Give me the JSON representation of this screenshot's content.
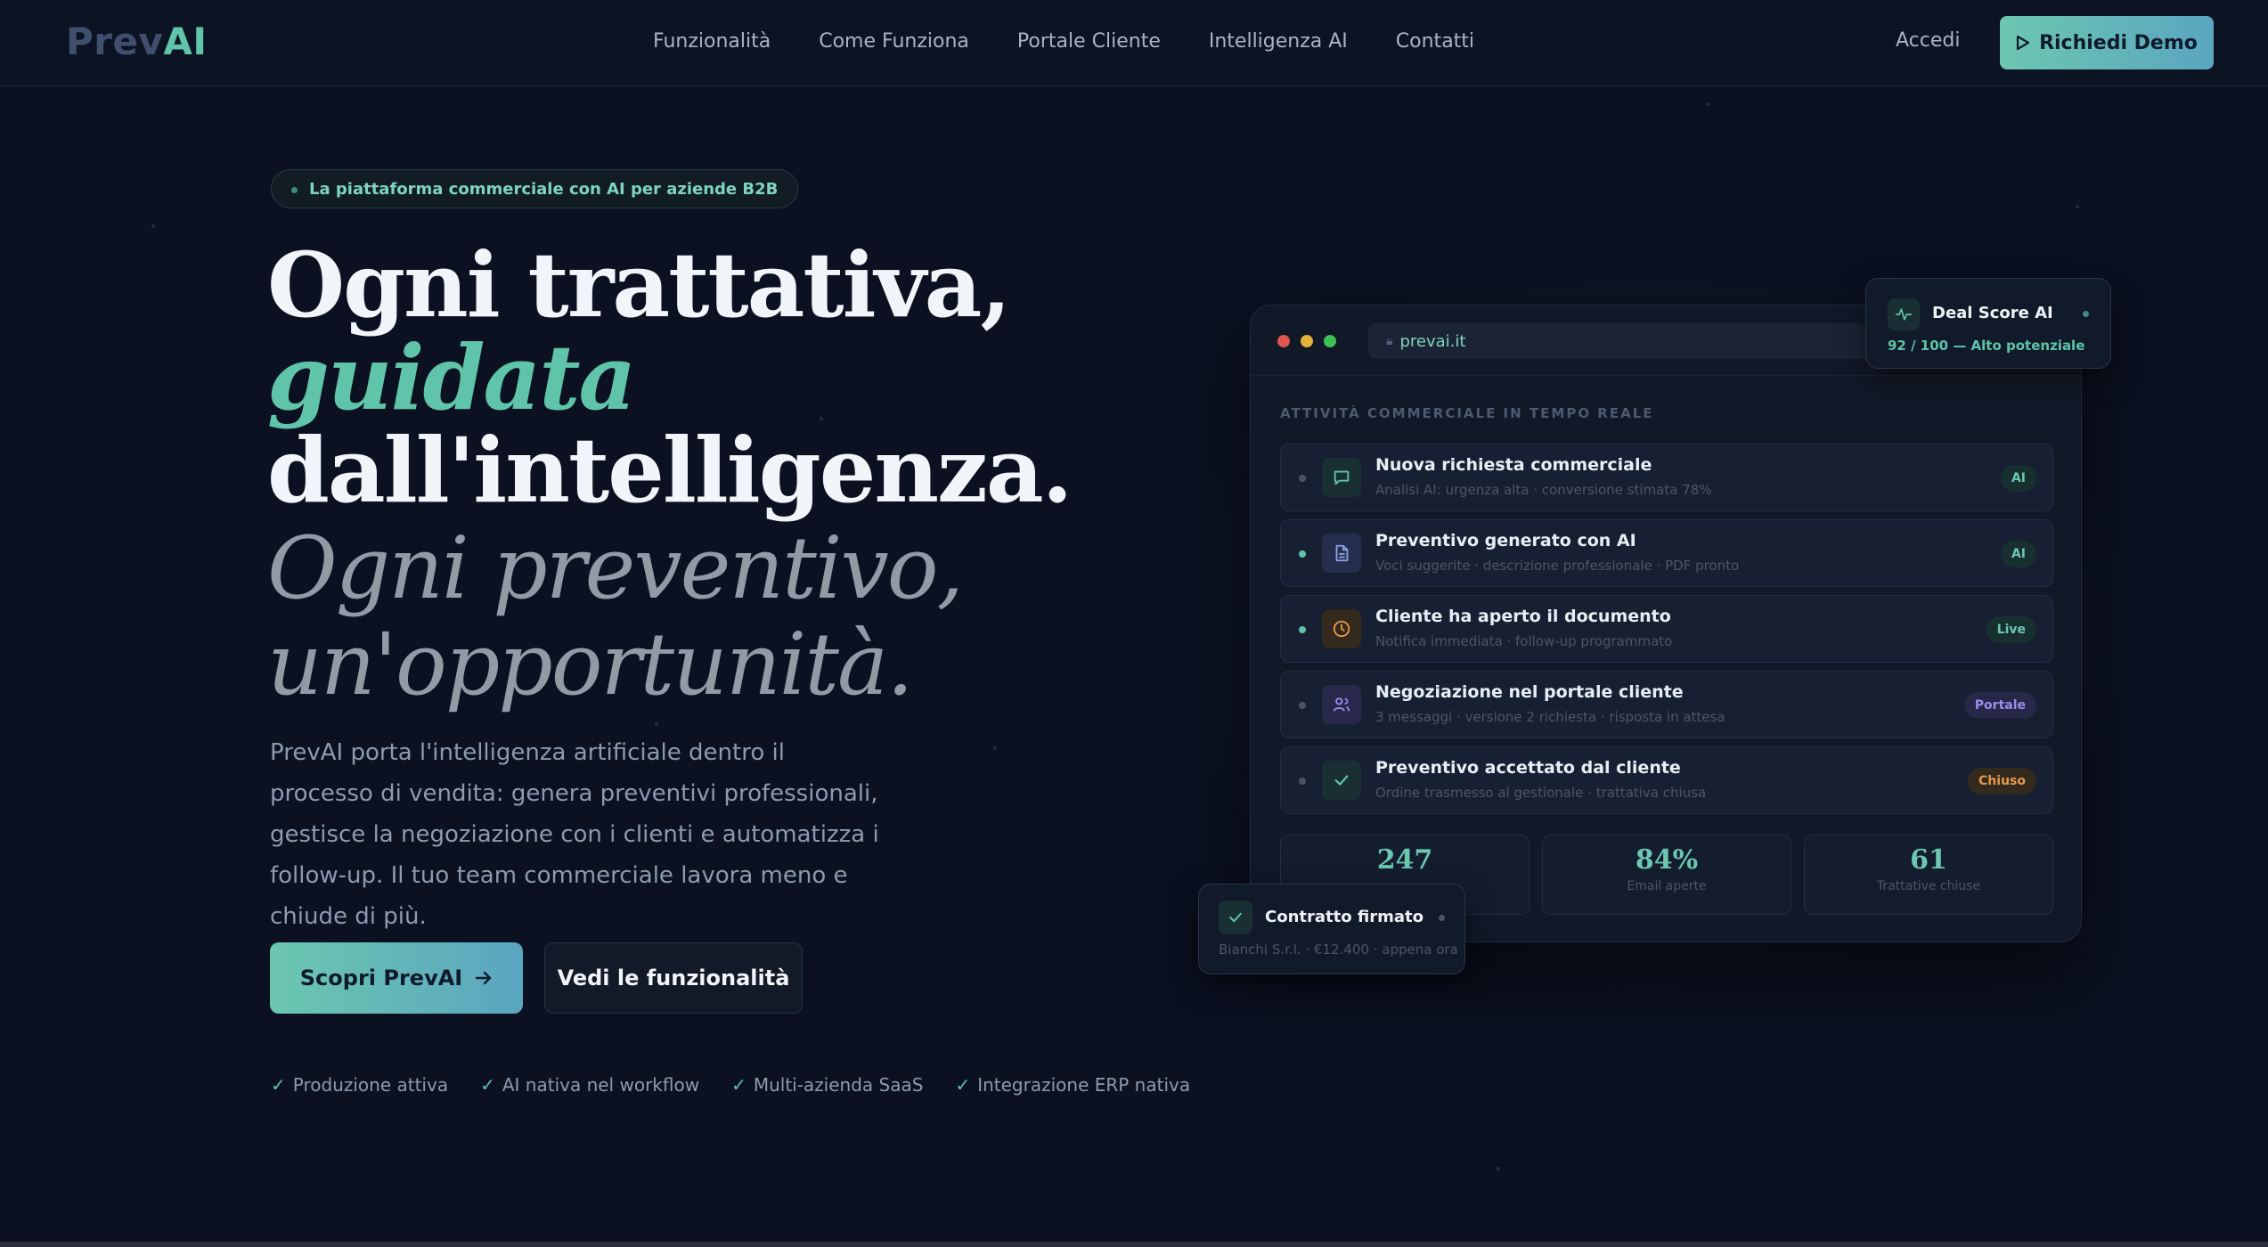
{
  "nav": {
    "logo_prev": "Prev",
    "logo_ai": "AI",
    "links": [
      "Funzionalità",
      "Come Funziona",
      "Portale Cliente",
      "Intelligenza AI",
      "Contatti"
    ],
    "login": "Accedi",
    "demo": "Richiedi Demo"
  },
  "hero": {
    "badge": "La piattaforma commerciale con AI per aziende B2B",
    "title_line1": "Ogni trattativa,",
    "title_line2": "guidata",
    "title_line3": "dall'intelligenza.",
    "subtitle_line1": "Ogni preventivo,",
    "subtitle_line2": "un'opportunità.",
    "paragraph": "PrevAI porta l'intelligenza artificiale dentro il processo di vendita: genera preventivi professionali, gestisce la negoziazione con i clienti e automatizza i follow-up. Il tuo team commerciale lavora meno e chiude di più.",
    "primary_cta": "Scopri PrevAI",
    "secondary_cta": "Vedi le funzionalità",
    "checks": [
      "Produzione attiva",
      "AI nativa nel workflow",
      "Multi-azienda SaaS",
      "Integrazione ERP nativa"
    ]
  },
  "mockup": {
    "url": "prevai.it",
    "section_title": "ATTIVITÀ COMMERCIALE IN TEMPO REALE",
    "rows": [
      {
        "title": "Nuova richiesta commerciale",
        "sub": "Analisi AI: urgenza alta · conversione stimata 78%",
        "tag": "AI",
        "icon": "chat-icon"
      },
      {
        "title": "Preventivo generato con AI",
        "sub": "Voci suggerite · descrizione professionale · PDF pronto",
        "tag": "AI",
        "icon": "document-icon"
      },
      {
        "title": "Cliente ha aperto il documento",
        "sub": "Notifica immediata · follow-up programmato",
        "tag": "Live",
        "icon": "clock-icon"
      },
      {
        "title": "Negoziazione nel portale cliente",
        "sub": "3 messaggi · versione 2 richiesta · risposta in attesa",
        "tag": "Portale",
        "icon": "users-icon"
      },
      {
        "title": "Preventivo accettato dal cliente",
        "sub": "Ordine trasmesso al gestionale · trattativa chiusa",
        "tag": "Chiuso",
        "icon": "check-icon"
      }
    ],
    "stats": [
      {
        "num": "247",
        "label": ""
      },
      {
        "num": "84%",
        "label": "Email aperte"
      },
      {
        "num": "61",
        "label": "Trattative chiuse"
      }
    ]
  },
  "deal_score": {
    "title": "Deal Score AI",
    "detail": "92 / 100 — Alto potenziale"
  },
  "contract": {
    "title": "Contratto firmato",
    "detail": "Bianchi S.r.l. · €12.400 · appena ora"
  },
  "colors": {
    "accent": "#5fc4a9",
    "background": "#0b1120",
    "orange": "#e79a4a",
    "purple": "#9b8cf0"
  }
}
